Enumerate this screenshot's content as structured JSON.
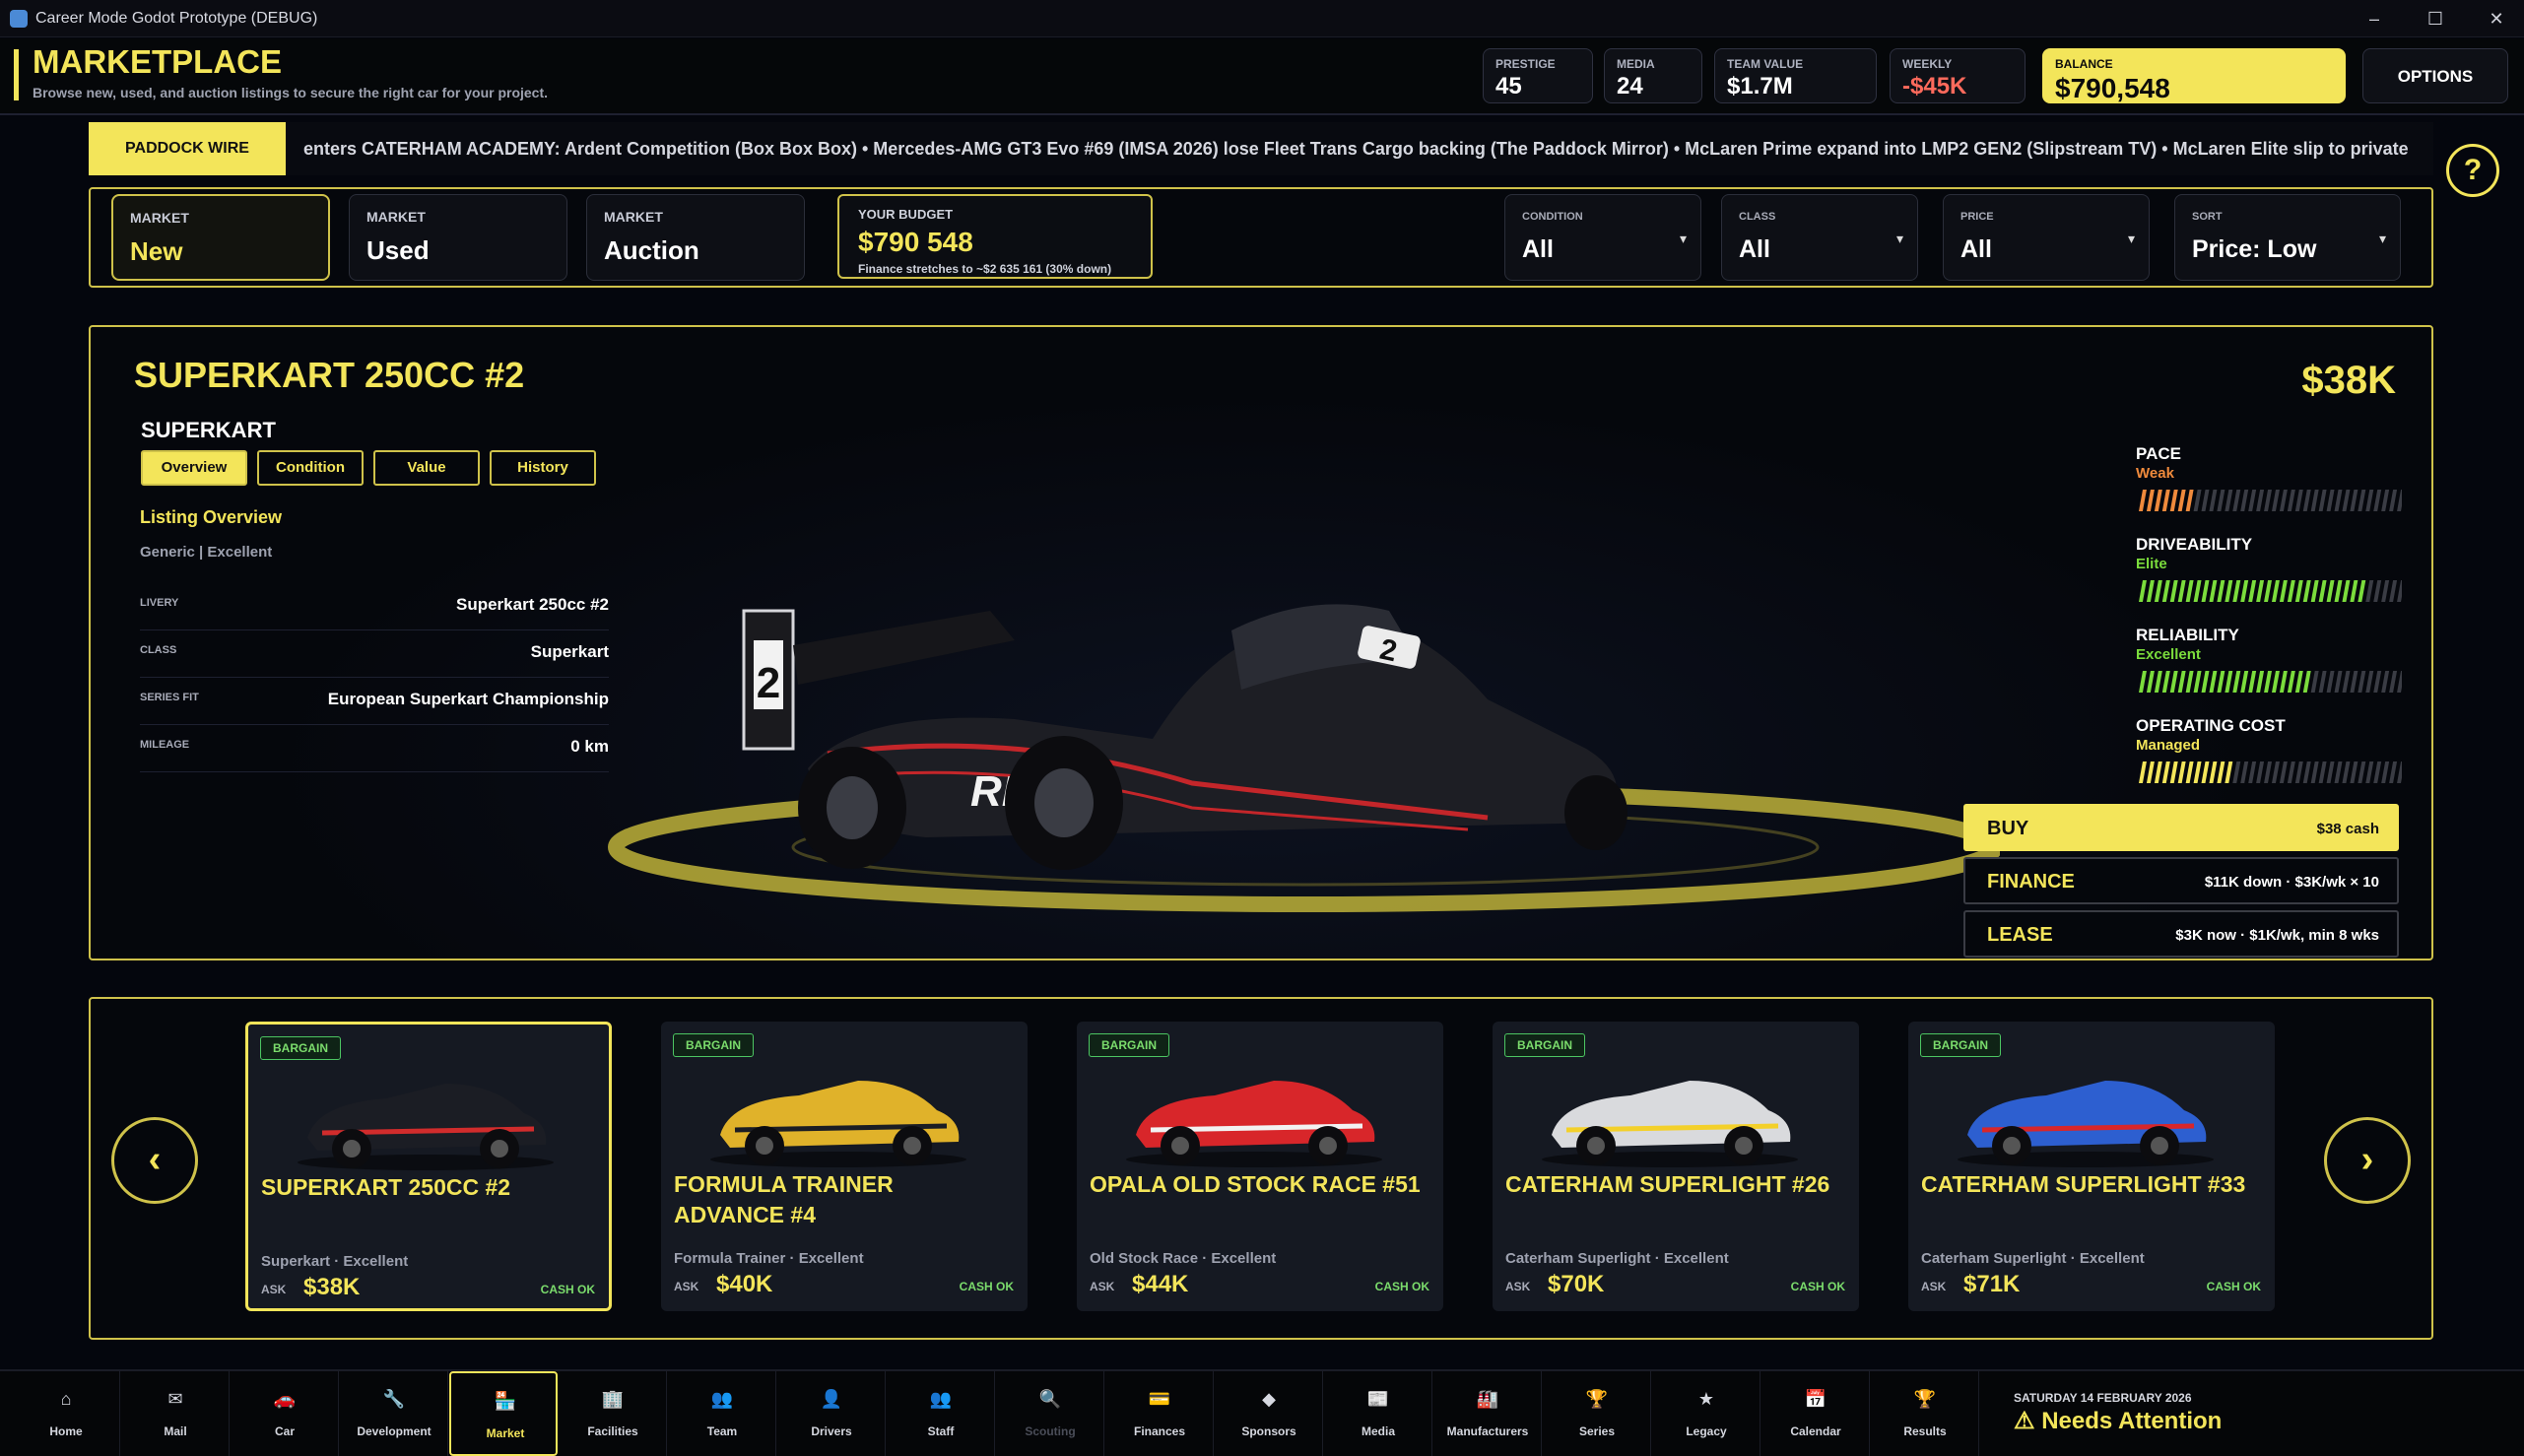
{
  "window": {
    "title": "Career Mode Godot Prototype (DEBUG)"
  },
  "header": {
    "title": "MARKETPLACE",
    "subtitle": "Browse new, used, and auction listings to secure the right car for your project.",
    "stats": [
      {
        "label": "PRESTIGE",
        "value": "45"
      },
      {
        "label": "MEDIA",
        "value": "24"
      },
      {
        "label": "TEAM VALUE",
        "value": "$1.7M"
      },
      {
        "label": "WEEKLY",
        "value": "-$45K"
      }
    ],
    "balance": {
      "label": "BALANCE",
      "value": "$790,548"
    },
    "options_label": "OPTIONS"
  },
  "wire": {
    "label": "PADDOCK WIRE",
    "ticker": "enters CATERHAM ACADEMY: Ardent Competition (Box Box Box)  •  Mercedes-AMG GT3 Evo #69 (IMSA 2026) lose Fleet Trans Cargo backing (The Paddock Mirror)  •  McLaren Prime expand into LMP2 GEN2 (Slipstream TV)  •  McLaren Elite slip to private"
  },
  "help_label": "?",
  "filters": {
    "markets": [
      {
        "label": "MARKET",
        "value": "New"
      },
      {
        "label": "MARKET",
        "value": "Used"
      },
      {
        "label": "MARKET",
        "value": "Auction"
      }
    ],
    "budget": {
      "label": "YOUR BUDGET",
      "value": "$790 548",
      "note": "Finance stretches to ~$2 635 161 (30% down)"
    },
    "dropdowns": [
      {
        "label": "CONDITION",
        "value": "All"
      },
      {
        "label": "CLASS",
        "value": "All"
      },
      {
        "label": "PRICE",
        "value": "All"
      },
      {
        "label": "SORT",
        "value": "Price: Low"
      }
    ]
  },
  "detail": {
    "title": "SUPERKART 250CC #2",
    "price": "$38K",
    "class_name": "SUPERKART",
    "tabs": [
      "Overview",
      "Condition",
      "Value",
      "History"
    ],
    "listing_heading": "Listing Overview",
    "listing_sub": "Generic | Excellent",
    "rows": [
      {
        "key": "LIVERY",
        "value": "Superkart 250cc #2"
      },
      {
        "key": "CLASS",
        "value": "Superkart"
      },
      {
        "key": "SERIES FIT",
        "value": "European Superkart Championship"
      },
      {
        "key": "MILEAGE",
        "value": "0 km"
      }
    ],
    "attributes": [
      {
        "name": "PACE",
        "rating": "Weak",
        "color": "#f08a3c",
        "level": 0.22
      },
      {
        "name": "DRIVEABILITY",
        "rating": "Elite",
        "color": "#7bdc3c",
        "level": 0.86
      },
      {
        "name": "RELIABILITY",
        "rating": "Excellent",
        "color": "#7bdc3c",
        "level": 0.66
      },
      {
        "name": "OPERATING COST",
        "rating": "Managed",
        "color": "#f3e55a",
        "level": 0.34
      }
    ],
    "actions": [
      {
        "name": "BUY",
        "detail": "$38 cash"
      },
      {
        "name": "FINANCE",
        "detail": "$11K down · $3K/wk × 10"
      },
      {
        "name": "LEASE",
        "detail": "$3K now · $1K/wk, min 8 wks"
      }
    ],
    "car_number": "2",
    "car_brand": "REIZA"
  },
  "carousel": {
    "cards": [
      {
        "badge": "BARGAIN",
        "name": "SUPERKART 250CC #2",
        "meta": "Superkart · Excellent",
        "ask": "ASK",
        "price": "$38K",
        "cash": "CASH OK",
        "color": "#1b1d24",
        "accent": "#d12c2c"
      },
      {
        "badge": "BARGAIN",
        "name": "FORMULA TRAINER ADVANCE #4",
        "meta": "Formula Trainer · Excellent",
        "ask": "ASK",
        "price": "$40K",
        "cash": "CASH OK",
        "color": "#e0b22a",
        "accent": "#1b1d24"
      },
      {
        "badge": "BARGAIN",
        "name": "OPALA OLD STOCK RACE #51",
        "meta": "Old Stock Race · Excellent",
        "ask": "ASK",
        "price": "$44K",
        "cash": "CASH OK",
        "color": "#d8262a",
        "accent": "#f2f2f2"
      },
      {
        "badge": "BARGAIN",
        "name": "CATERHAM SUPERLIGHT #26",
        "meta": "Caterham Superlight · Excellent",
        "ask": "ASK",
        "price": "$70K",
        "cash": "CASH OK",
        "color": "#d9dadd",
        "accent": "#f3d02a"
      },
      {
        "badge": "BARGAIN",
        "name": "CATERHAM SUPERLIGHT #33",
        "meta": "Caterham Superlight · Excellent",
        "ask": "ASK",
        "price": "$71K",
        "cash": "CASH OK",
        "color": "#2d5fd0",
        "accent": "#d8262a"
      }
    ]
  },
  "nav": [
    {
      "label": "Home",
      "icon": "⌂"
    },
    {
      "label": "Mail",
      "icon": "✉"
    },
    {
      "label": "Car",
      "icon": "🚗"
    },
    {
      "label": "Development",
      "icon": "🔧"
    },
    {
      "label": "Market",
      "icon": "🏪"
    },
    {
      "label": "Facilities",
      "icon": "🏢"
    },
    {
      "label": "Team",
      "icon": "👥"
    },
    {
      "label": "Drivers",
      "icon": "👤"
    },
    {
      "label": "Staff",
      "icon": "👥"
    },
    {
      "label": "Scouting",
      "icon": "🔍"
    },
    {
      "label": "Finances",
      "icon": "💳"
    },
    {
      "label": "Sponsors",
      "icon": "◆"
    },
    {
      "label": "Media",
      "icon": "📰"
    },
    {
      "label": "Manufacturers",
      "icon": "🏭"
    },
    {
      "label": "Series",
      "icon": "🏆"
    },
    {
      "label": "Legacy",
      "icon": "★"
    },
    {
      "label": "Calendar",
      "icon": "📅"
    },
    {
      "label": "Results",
      "icon": "🏆"
    }
  ],
  "status": {
    "date": "SATURDAY 14 FEBRUARY 2026",
    "attention": "Needs Attention",
    "warning_icon": "⚠"
  }
}
